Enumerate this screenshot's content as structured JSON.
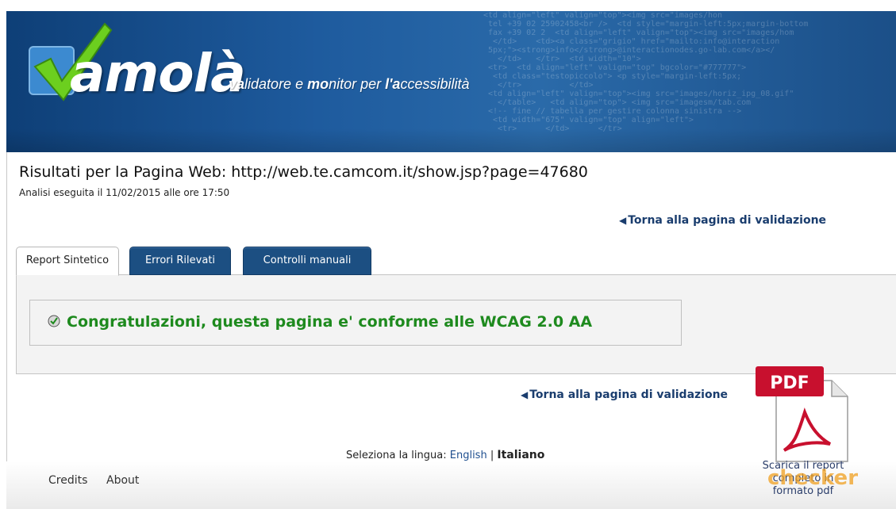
{
  "header": {
    "logo_word": "amolà",
    "tagline_parts": [
      "va",
      "lidatore e ",
      "mo",
      "nitor per ",
      "l'a",
      "ccessibilità"
    ]
  },
  "results": {
    "title": "Risultati per la Pagina Web: http://web.te.camcom.it/show.jsp?page=47680",
    "analysis_date": "Analisi eseguita il 11/02/2015 alle ore 17:50",
    "back_link_top": "Torna alla pagina di validazione",
    "back_link_bottom": "Torna alla pagina di validazione"
  },
  "tabs": [
    {
      "label": "Report Sintetico",
      "active": true
    },
    {
      "label": "Errori Rilevati",
      "active": false
    },
    {
      "label": "Controlli manuali",
      "active": false
    }
  ],
  "notice": {
    "message": "Congratulazioni, questa pagina e' conforme alle WCAG 2.0 AA",
    "icon": "check-circle-icon"
  },
  "pdf": {
    "badge": "PDF",
    "label": "Scarica il report completo in formato pdf"
  },
  "language": {
    "prompt": "Seleziona la lingua:",
    "english": "English",
    "separator": "|",
    "italian": "Italiano"
  },
  "footer": {
    "credits": "Credits",
    "about": "About"
  },
  "watermark": "checker",
  "colors": {
    "banner": "#1e5b9e",
    "tab_blue": "#1c4f82",
    "success_green": "#1e8a1e",
    "link_blue": "#1a3d6e",
    "pdf_red": "#c8102e"
  }
}
